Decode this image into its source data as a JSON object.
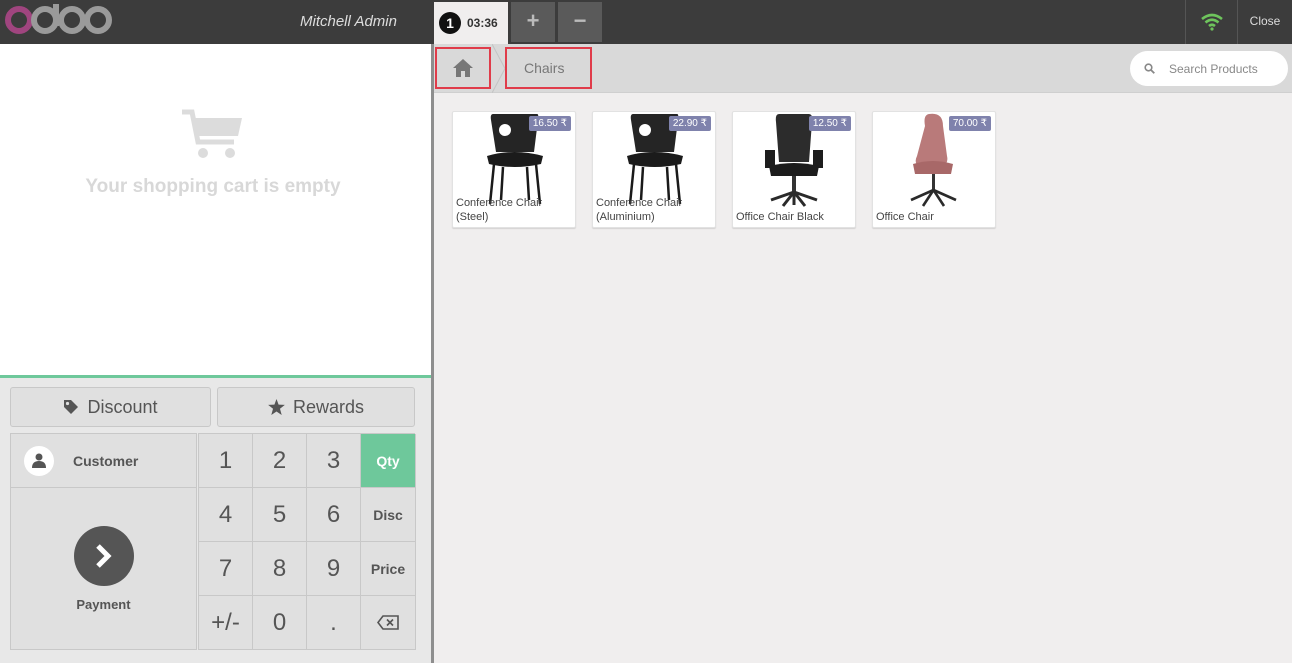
{
  "header": {
    "username": "Mitchell Admin",
    "order_number": "1",
    "order_time": "03:36",
    "add_label": "+",
    "remove_label": "−",
    "close_label": "Close",
    "wifi_color": "#6ec45c"
  },
  "cart": {
    "empty_message": "Your shopping cart is empty"
  },
  "control_buttons": {
    "discount_label": "Discount",
    "rewards_label": "Rewards"
  },
  "actionpad": {
    "customer_label": "Customer",
    "payment_label": "Payment"
  },
  "numpad": {
    "keys": [
      "1",
      "2",
      "3",
      "Qty",
      "4",
      "5",
      "6",
      "Disc",
      "7",
      "8",
      "9",
      "Price",
      "+/-",
      "0",
      "."
    ],
    "active_mode": "Qty",
    "accent_color": "#6ec89b"
  },
  "breadcrumbs": {
    "category": "Chairs"
  },
  "search": {
    "placeholder": "Search Products"
  },
  "products": [
    {
      "name": "Conference Chair (Steel)",
      "price": "16.50 ₹",
      "chair": "conference"
    },
    {
      "name": "Conference Chair (Aluminium)",
      "price": "22.90 ₹",
      "chair": "conference"
    },
    {
      "name": "Office Chair Black",
      "price": "12.50 ₹",
      "chair": "office-black"
    },
    {
      "name": "Office Chair",
      "price": "70.00 ₹",
      "chair": "office-pink"
    }
  ]
}
